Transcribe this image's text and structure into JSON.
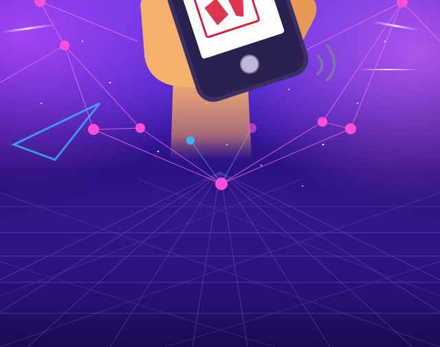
{
  "scene": {
    "background_top": "#6a3df0",
    "background_mid": "#3a1aa8",
    "background_bottom": "#1e0b5f",
    "grid_color": "#a07cff",
    "node_color": "#ff4fd8",
    "line_color": "#ff77e6",
    "accent_blue": "#3fb2ff",
    "hand_color": "#f5b06d",
    "phone_frame_color": "#3b2f66",
    "phone_screen_color": "#ffffff",
    "phone_logo_color": "#d81f3a"
  },
  "phone": {
    "logo_text": "",
    "vibration_icon": "vibration-icon"
  }
}
